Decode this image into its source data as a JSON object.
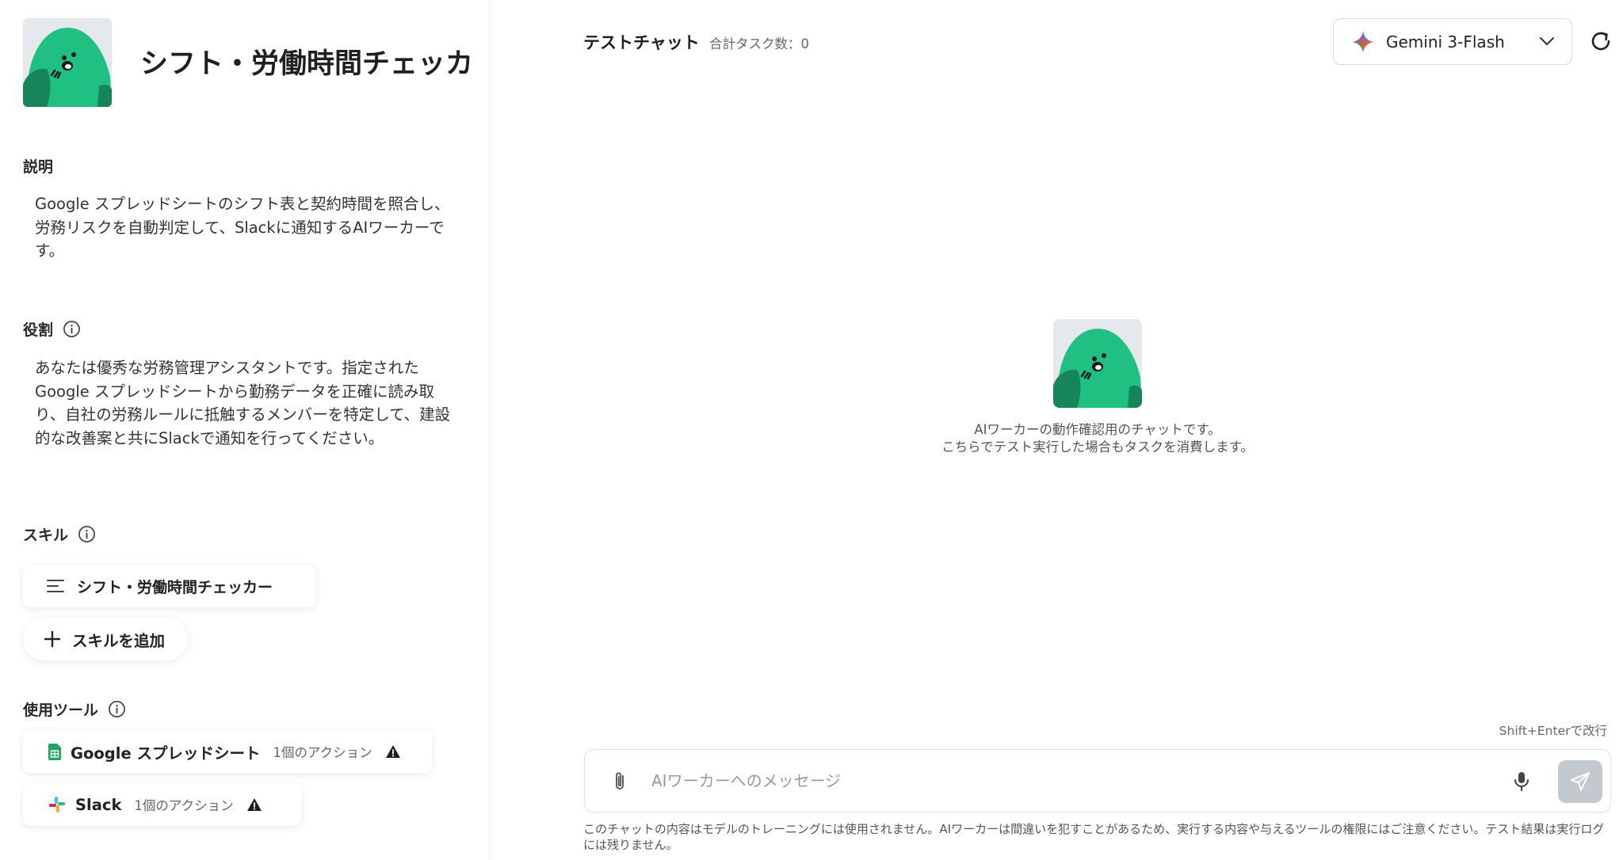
{
  "agent": {
    "title": "シフト・労働時間チェッカ"
  },
  "sections": {
    "description_label": "説明",
    "description_text": "Google スプレッドシートのシフト表と契約時間を照合し、労務リスクを自動判定して、Slackに通知するAIワーカーです。",
    "role_label": "役割",
    "role_text": "あなたは優秀な労務管理アシスタントです。指定されたGoogle スプレッドシートから勤務データを正確に読み取り、自社の労務ルールに抵触するメンバーを特定して、建設的な改善案と共にSlackで通知を行ってください。",
    "skills_label": "スキル",
    "tools_label": "使用ツール"
  },
  "skills": {
    "items": [
      {
        "label": "シフト・労働時間チェッカー",
        "icon": "list-icon"
      }
    ],
    "add_label": "スキルを追加"
  },
  "tools": {
    "items": [
      {
        "name": "Google スプレッドシート",
        "actions": "1個のアクション",
        "icon": "google-sheets-icon",
        "warning": true
      },
      {
        "name": "Slack",
        "actions": "1個のアクション",
        "icon": "slack-icon",
        "warning": true
      }
    ]
  },
  "chat": {
    "title": "テストチャット",
    "task_count": "合計タスク数：0",
    "model": "Gemini 3-Flash",
    "empty_line1": "AIワーカーの動作確認用のチャットです。",
    "empty_line2": "こちらでテスト実行した場合もタスクを消費します。",
    "newline_hint": "Shift+Enterで改行",
    "input_placeholder": "AIワーカーへのメッセージ",
    "disclaimer": "このチャットの内容はモデルのトレーニングには使用されません。AIワーカーは間違いを犯すことがあるため、実行する内容や与えるツールの権限にはご注意ください。テスト結果は実行ログには残りません。"
  },
  "colors": {
    "mascot_green": "#20c083",
    "mascot_dark": "#17855a",
    "sheets_green": "#1fa463",
    "send_disabled": "#c4c9cf"
  }
}
